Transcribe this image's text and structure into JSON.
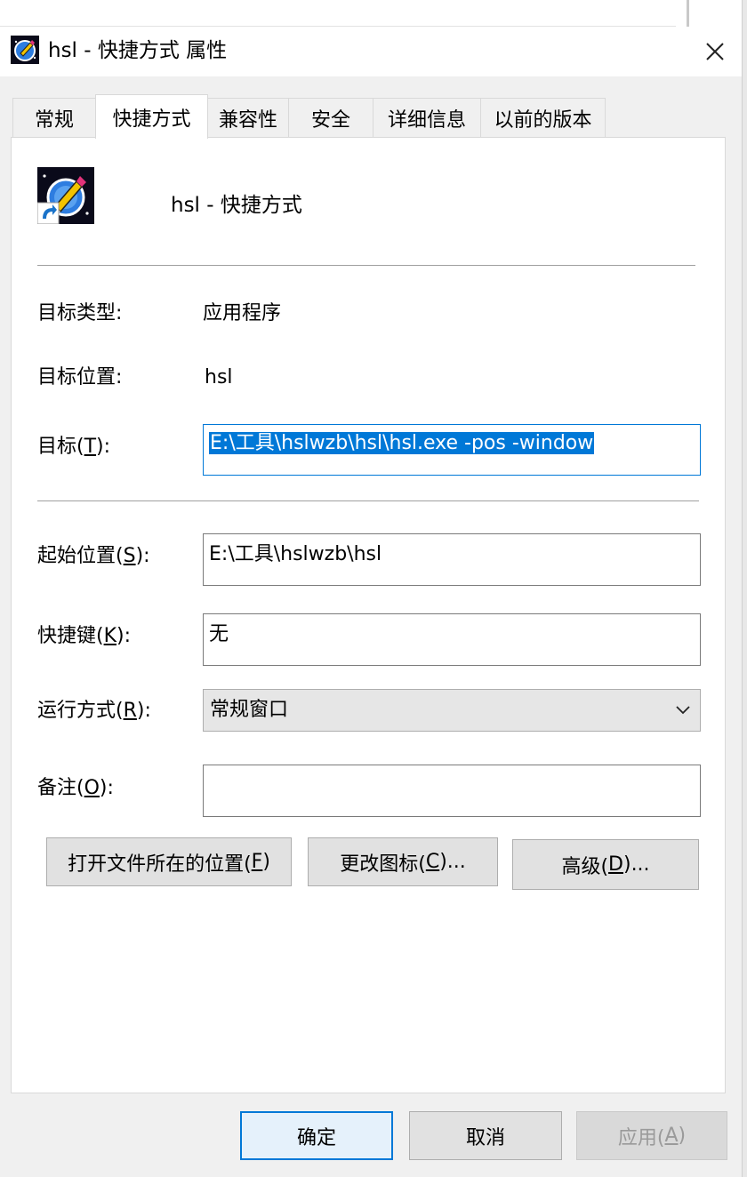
{
  "window": {
    "title": "hsl - 快捷方式 属性",
    "close_glyph": "✕"
  },
  "tabs": [
    {
      "label": "常规",
      "active": false
    },
    {
      "label": "快捷方式",
      "active": true
    },
    {
      "label": "兼容性",
      "active": false
    },
    {
      "label": "安全",
      "active": false
    },
    {
      "label": "详细信息",
      "active": false
    },
    {
      "label": "以前的版本",
      "active": false
    }
  ],
  "shortcut": {
    "name": "hsl - 快捷方式",
    "icon": "app-shortcut-icon"
  },
  "info": {
    "target_type_label": "目标类型:",
    "target_type_value": "应用程序",
    "target_location_label": "目标位置:",
    "target_location_value": "hsl"
  },
  "fields": {
    "target_label_pre": "目标(",
    "target_label_key": "T",
    "target_label_post": "):",
    "target_value": "E:\\工具\\hslwzb\\hsl\\hsl.exe -pos -window",
    "start_label_pre": "起始位置(",
    "start_label_key": "S",
    "start_label_post": "):",
    "start_value": "E:\\工具\\hslwzb\\hsl",
    "hotkey_label_pre": "快捷键(",
    "hotkey_label_key": "K",
    "hotkey_label_post": "):",
    "hotkey_value": "无",
    "run_label_pre": "运行方式(",
    "run_label_key": "R",
    "run_label_post": "):",
    "run_value": "常规窗口",
    "comment_label_pre": "备注(",
    "comment_label_key": "O",
    "comment_label_post": "):",
    "comment_value": ""
  },
  "actions": {
    "open_location_pre": "打开文件所在的位置(",
    "open_location_key": "F",
    "open_location_post": ")",
    "change_icon_pre": "更改图标(",
    "change_icon_key": "C",
    "change_icon_post": ")...",
    "advanced_pre": "高级(",
    "advanced_key": "D",
    "advanced_post": ")..."
  },
  "footer": {
    "ok": "确定",
    "cancel": "取消",
    "apply_pre": "应用(",
    "apply_key": "A",
    "apply_post": ")"
  },
  "colors": {
    "accent": "#0078d7",
    "selection": "#0078d7",
    "window_bg": "#f0f0f0"
  }
}
